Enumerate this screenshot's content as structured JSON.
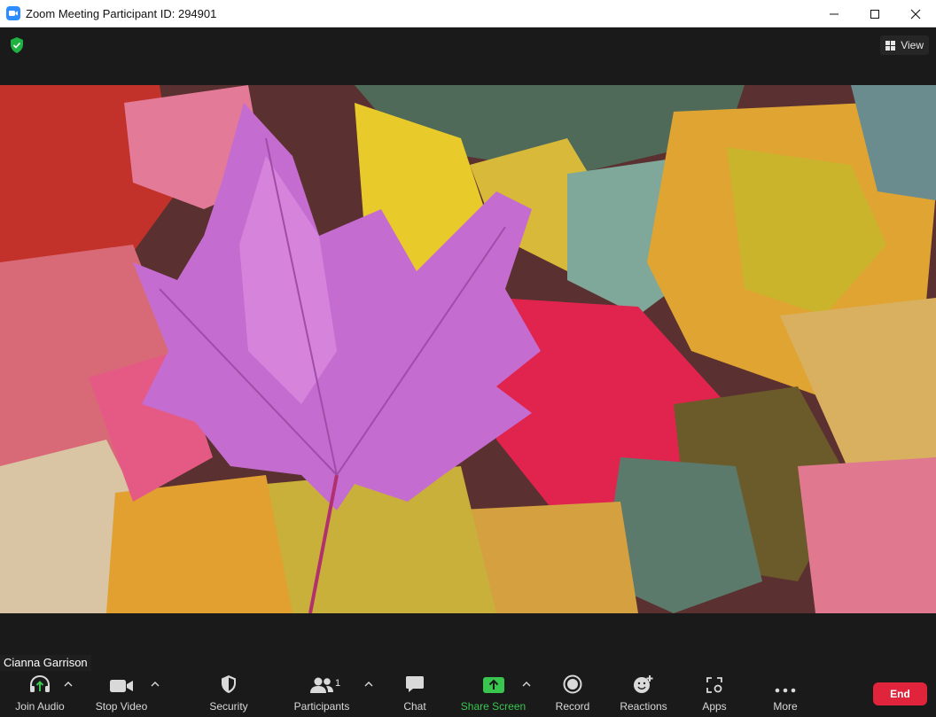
{
  "window": {
    "title": "Zoom Meeting Participant ID: 294901",
    "controls": [
      "minimize-icon",
      "maximize-icon",
      "close-icon"
    ]
  },
  "topbar": {
    "security_indicator": "green-shield-icon",
    "view_label": "View"
  },
  "video": {
    "participant_name": "Cianna Garrison"
  },
  "toolbar": {
    "join_audio": "Join Audio",
    "stop_video": "Stop Video",
    "security": "Security",
    "participants": "Participants",
    "participants_count": "1",
    "chat": "Chat",
    "share_screen": "Share Screen",
    "record": "Record",
    "reactions": "Reactions",
    "apps": "Apps",
    "more": "More",
    "end": "End"
  },
  "colors": {
    "accent_green": "#39c64e",
    "end_red": "#e0243c",
    "background": "#1a1a1a"
  }
}
